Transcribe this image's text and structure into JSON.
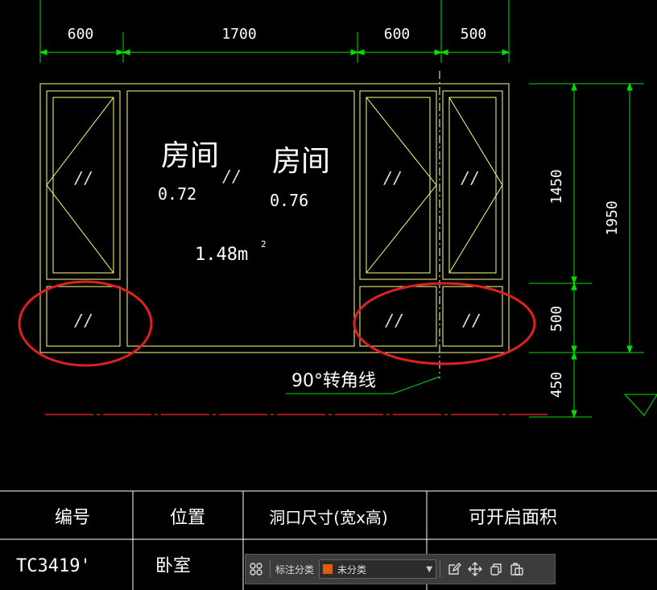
{
  "colors": {
    "background": "#000000",
    "dimension": "#00e000",
    "window": "#ffff80",
    "text": "#ffffff",
    "annotation": "#e02020",
    "baseline": "#d82020",
    "table_line": "#ffffff",
    "swatch": "#e05a10"
  },
  "dimensions": {
    "top": [
      "600",
      "1700",
      "600",
      "500"
    ],
    "right": [
      "1450",
      "500",
      "450"
    ],
    "total_height": "1950"
  },
  "labels": {
    "room_1": "房间",
    "room_2": "房间",
    "value_1": "0.72",
    "value_2": "0.76",
    "area": "1.48m",
    "area_exp": "2",
    "corner_note": "90°转角线",
    "glass": "//"
  },
  "table": {
    "headers": [
      "编号",
      "位置",
      "洞口尺寸(宽x高)",
      "可开启面积"
    ],
    "row": [
      "TC3419'",
      "卧室",
      "",
      ""
    ]
  },
  "toolbar": {
    "grid_icon": "grid-icon",
    "label": "标注分类",
    "select_value": "未分类",
    "icons": [
      "edit-icon",
      "move-icon",
      "copy-icon",
      "paste-icon"
    ]
  }
}
